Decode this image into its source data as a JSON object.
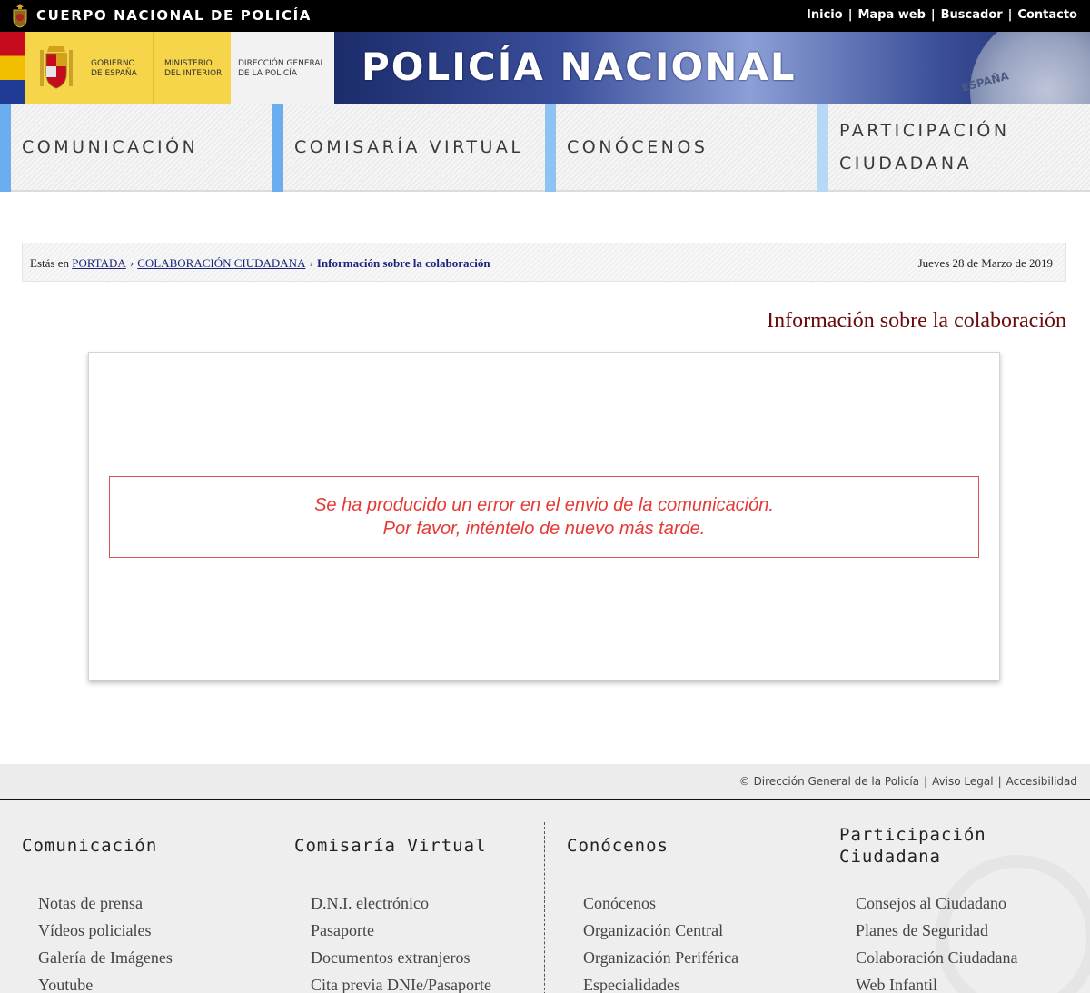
{
  "topbar": {
    "site_name": "CUERPO NACIONAL DE POLICÍA",
    "links": [
      "Inicio",
      "Mapa web",
      "Buscador",
      "Contacto"
    ]
  },
  "banner": {
    "gob_text": [
      "GOBIERNO",
      "DE ESPAÑA"
    ],
    "ministerio_text": [
      "MINISTERIO",
      "DEL INTERIOR"
    ],
    "direccion_text": [
      "DIRECCIÓN GENERAL",
      "DE LA POLICÍA"
    ],
    "title": "POLICÍA NACIONAL",
    "badge_text": "ESPAÑA"
  },
  "nav": {
    "items": [
      {
        "label": "COMUNICACIÓN"
      },
      {
        "label": "COMISARÍA VIRTUAL"
      },
      {
        "label": "CONÓCENOS"
      },
      {
        "label_line1": "PARTICIPACIÓN",
        "label_line2": "CIUDADANA"
      }
    ]
  },
  "breadcrumb": {
    "prefix": "Estás en",
    "links": [
      "PORTADA",
      "COLABORACIÓN CIUDADANA"
    ],
    "current": "Información sobre la colaboración",
    "date": "Jueves 28 de Marzo de 2019"
  },
  "page": {
    "title": "Información sobre la colaboración",
    "error_line1": "Se ha producido un error en el envio de la comunicación.",
    "error_line2": "Por favor, inténtelo de nuevo más tarde."
  },
  "footer": {
    "copyright": "© Dirección General de la Policía",
    "legal": "Aviso Legal",
    "accessibility": "Accesibilidad",
    "columns": [
      {
        "title": "Comunicación",
        "items": [
          "Notas de prensa",
          "Vídeos policiales",
          "Galería de Imágenes",
          "Youtube"
        ]
      },
      {
        "title": "Comisaría Virtual",
        "items": [
          "D.N.I. electrónico",
          "Pasaporte",
          "Documentos extranjeros",
          "Cita previa DNIe/Pasaporte"
        ]
      },
      {
        "title": "Conócenos",
        "items": [
          "Conócenos",
          "Organización Central",
          "Organización Periférica",
          "Especialidades"
        ]
      },
      {
        "title_line1": "Participación",
        "title_line2": "Ciudadana",
        "items": [
          "Consejos al Ciudadano",
          "Planes de Seguridad",
          "Colaboración Ciudadana",
          "Web Infantil"
        ]
      }
    ]
  },
  "colors": {
    "nav_accent": "#6aaef0",
    "page_title": "#6b0a0a",
    "error": "#e53935"
  }
}
